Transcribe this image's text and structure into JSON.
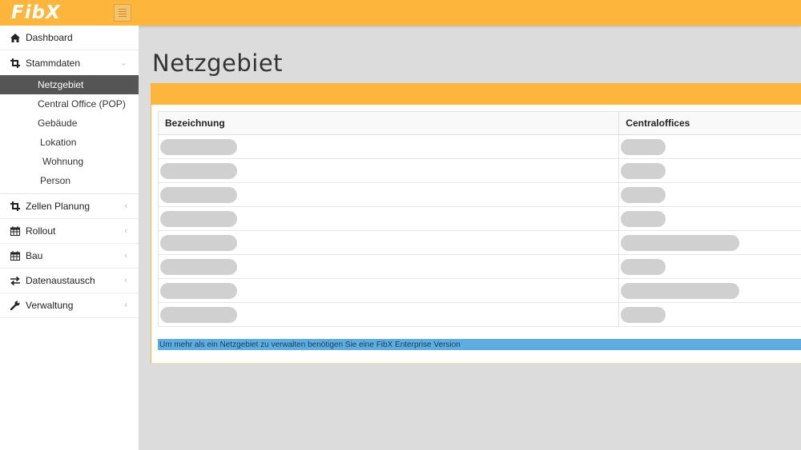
{
  "app": {
    "logo_text": "FibX"
  },
  "colors": {
    "accent": "#fdb53c",
    "notice": "#5dade2",
    "active_nav": "#555555"
  },
  "sidebar": {
    "items": [
      {
        "label": "Dashboard",
        "icon": "home-icon"
      },
      {
        "label": "Stammdaten",
        "icon": "crop-icon",
        "open": true,
        "children": [
          {
            "label": "Netzgebiet",
            "active": true
          },
          {
            "label": "Central Office (POP)"
          },
          {
            "label": "Gebäude"
          },
          {
            "label": "Lokation"
          },
          {
            "label": "Wohnung"
          },
          {
            "label": "Person"
          }
        ]
      },
      {
        "label": "Zellen Planung",
        "icon": "crop-icon"
      },
      {
        "label": "Rollout",
        "icon": "calendar-icon"
      },
      {
        "label": "Bau",
        "icon": "calendar-icon"
      },
      {
        "label": "Datenaustausch",
        "icon": "exchange-icon"
      },
      {
        "label": "Verwaltung",
        "icon": "wrench-icon"
      }
    ]
  },
  "main": {
    "title": "Netzgebiet",
    "table": {
      "columns": [
        "Bezeichnung",
        "Centraloffices"
      ],
      "rows": [
        {
          "state": "loading"
        },
        {
          "state": "loading"
        },
        {
          "state": "loading"
        },
        {
          "state": "loading"
        },
        {
          "state": "loading"
        },
        {
          "state": "loading"
        },
        {
          "state": "loading"
        },
        {
          "state": "loading"
        }
      ]
    },
    "notice": "Um mehr als ein Netzgebiet zu verwalten benötigen Sie eine FibX Enterprise Version"
  }
}
